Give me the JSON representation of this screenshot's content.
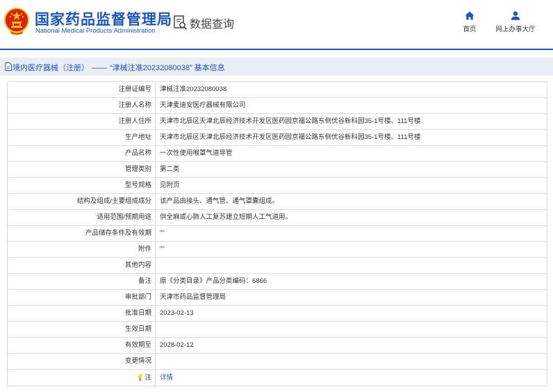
{
  "header": {
    "site_name_cn": "国家药品监督管理局",
    "site_name_en": "National Medical Products Administration",
    "database_query_label": "数据查询",
    "nav": {
      "home_label": "首页",
      "office_label": "网上办事大厅"
    }
  },
  "breadcrumb": {
    "section": "境内医疗器械（注册）",
    "separator": "——",
    "current": "“津械注准20232080038” 基本信息"
  },
  "details": {
    "registration_no": {
      "label": "注册证编号",
      "value": "津械注准20232080038"
    },
    "registrant_name": {
      "label": "注册人名称",
      "value": "天津麦迪安医疗器械有限公司"
    },
    "registrant_address": {
      "label": "注册人住所",
      "value": "天津市北辰区天津北辰经济技术开发区医药园京福公路东侧优谷新科园35-1号楼、111号楼"
    },
    "production_address": {
      "label": "生产地址",
      "value": "天津市北辰区天津北辰经济技术开发区医药园京福公路东侧优谷新科园35-1号楼、111号楼"
    },
    "product_name": {
      "label": "产品名称",
      "value": "一次性使用喉罩气道导管"
    },
    "management_class": {
      "label": "管理类别",
      "value": "第二类"
    },
    "model_spec": {
      "label": "型号规格",
      "value": "见附页"
    },
    "structure": {
      "label": "结构及组成/主要组成成分",
      "value": "该产品由接头、通气管、通气罩囊组成。"
    },
    "intended_use": {
      "label": "适用范围/预期用途",
      "value": "供全麻或心肺人工复苏建立短期人工气道用。"
    },
    "storage": {
      "label": "产品储存条件及有效期",
      "value": "\"\""
    },
    "attachment": {
      "label": "附件",
      "value": "\"\""
    },
    "other": {
      "label": "其他内容",
      "value": ""
    },
    "remarks": {
      "label": "备注",
      "value": "原《分类目录》产品分类编码：6866"
    },
    "approval_dept": {
      "label": "审批部门",
      "value": "天津市药品监督管理局"
    },
    "approval_date": {
      "label": "批准日期",
      "value": "2023-02-13"
    },
    "effective_date": {
      "label": "生效日期",
      "value": ""
    },
    "expiry_date": {
      "label": "有效期至",
      "value": "2028-02-12"
    },
    "changes": {
      "label": "变更情况",
      "value": ""
    },
    "note": {
      "label": "注",
      "icon": "lightbulb-icon",
      "value": "详情"
    }
  },
  "colors": {
    "brand_blue": "#1d57b6",
    "emblem_red": "#d7221a",
    "emblem_gold": "#f2c21b",
    "breadcrumb_bg": "#e9eef5",
    "table_border": "#dcdcdc"
  }
}
